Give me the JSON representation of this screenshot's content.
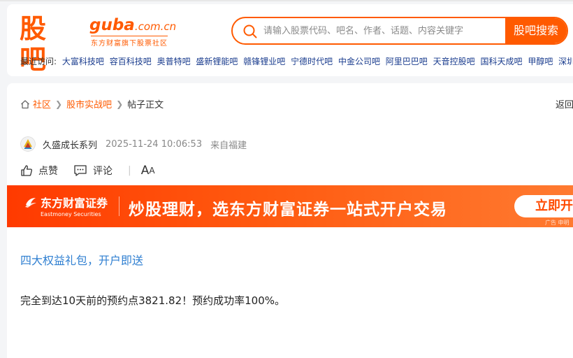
{
  "logo": {
    "cn": "股吧",
    "en": "guba",
    "domain": ".com.cn",
    "tagline": "东方财富旗下股票社区"
  },
  "search": {
    "placeholder": "请输入股票代码、吧名、作者、话题、内容关键字",
    "button_label": "股吧搜索"
  },
  "recent": {
    "label": "最近访问:",
    "items": [
      "大富科技吧",
      "容百科技吧",
      "奥普特吧",
      "盛新锂能吧",
      "赣锋锂业吧",
      "宁德时代吧",
      "中金公司吧",
      "阿里巴巴吧",
      "天音控股吧",
      "国科天成吧",
      "甲醇吧",
      "深圳华"
    ]
  },
  "breadcrumb": {
    "home": "社区",
    "forum": "股市实战吧",
    "current": "帖子正文",
    "back": "返回股"
  },
  "post": {
    "author": "久盛成长系列",
    "time": "2025-11-24 10:06:53",
    "from": "来自福建",
    "like_label": "点赞",
    "comment_label": "评论",
    "font_big": "A",
    "font_small": "A",
    "promo_link": "四大权益礼包，开户即送",
    "body": "完全到达10天前的预约点3821.82！预约成功率100%。"
  },
  "banner": {
    "brand_cn": "东方财富证券",
    "brand_en": "Eastmoney Securities",
    "slogan": "炒股理财，选东方财富证券一站式开户交易",
    "cta": "立即开",
    "ad_tag": "广告 申明"
  },
  "colors": {
    "brand": "#ff5a00",
    "link_blue": "#1a3c8e",
    "promo_blue": "#2f7fd1"
  }
}
